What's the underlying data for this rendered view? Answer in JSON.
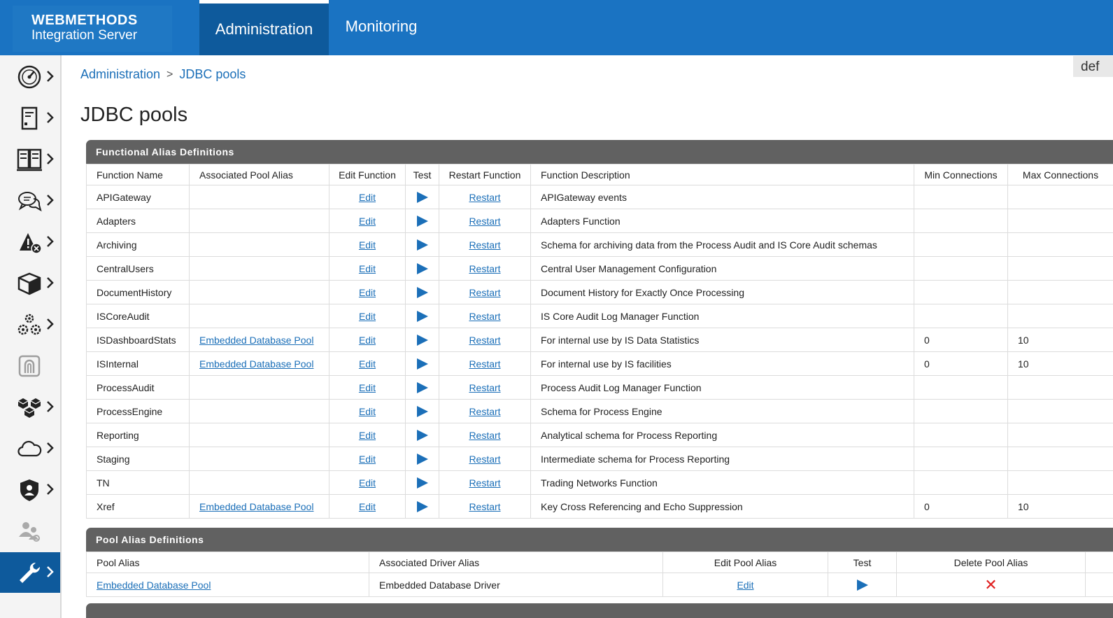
{
  "brand": {
    "line1": "WEBMETHODS",
    "line2": "Integration Server"
  },
  "tabs": [
    {
      "label": "Administration",
      "active": true
    },
    {
      "label": "Monitoring",
      "active": false
    }
  ],
  "sidebar": {
    "items": [
      {
        "icon": "dashboard-gauge-icon"
      },
      {
        "icon": "server-document-icon"
      },
      {
        "icon": "packages-grid-icon"
      },
      {
        "icon": "messaging-chat-icon"
      },
      {
        "icon": "security-alert-icon"
      },
      {
        "icon": "package-box-icon"
      },
      {
        "icon": "settings-gears-icon"
      },
      {
        "icon": "api-portal-icon"
      },
      {
        "icon": "solutions-cubes-icon"
      },
      {
        "icon": "cloud-icon"
      },
      {
        "icon": "security-shield-user-icon"
      },
      {
        "icon": "users-group-icon"
      },
      {
        "icon": "wrench-icon",
        "active": true
      }
    ]
  },
  "breadcrumb": {
    "root": "Administration",
    "separator": ">",
    "current": "JDBC pools"
  },
  "page_title": "JDBC pools",
  "corner_text": "def",
  "functional": {
    "title": "Functional Alias Definitions",
    "headers": [
      "Function Name",
      "Associated Pool Alias",
      "Edit Function",
      "Test",
      "Restart Function",
      "Function Description",
      "Min Connections",
      "Max Connections"
    ],
    "edit_label": "Edit",
    "restart_label": "Restart",
    "rows": [
      {
        "name": "APIGateway",
        "pool": "",
        "desc": "APIGateway events",
        "min": "",
        "max": ""
      },
      {
        "name": "Adapters",
        "pool": "",
        "desc": "Adapters Function",
        "min": "",
        "max": ""
      },
      {
        "name": "Archiving",
        "pool": "",
        "desc": "Schema for archiving data from the Process Audit and IS Core Audit schemas",
        "min": "",
        "max": ""
      },
      {
        "name": "CentralUsers",
        "pool": "",
        "desc": "Central User Management Configuration",
        "min": "",
        "max": ""
      },
      {
        "name": "DocumentHistory",
        "pool": "",
        "desc": "Document History for Exactly Once Processing",
        "min": "",
        "max": ""
      },
      {
        "name": "ISCoreAudit",
        "pool": "",
        "desc": "IS Core Audit Log Manager Function",
        "min": "",
        "max": ""
      },
      {
        "name": "ISDashboardStats",
        "pool": "Embedded Database Pool",
        "desc": "For internal use by IS Data Statistics",
        "min": "0",
        "max": "10"
      },
      {
        "name": "ISInternal",
        "pool": "Embedded Database Pool",
        "desc": "For internal use by IS facilities",
        "min": "0",
        "max": "10"
      },
      {
        "name": "ProcessAudit",
        "pool": "",
        "desc": "Process Audit Log Manager Function",
        "min": "",
        "max": ""
      },
      {
        "name": "ProcessEngine",
        "pool": "",
        "desc": "Schema for Process Engine",
        "min": "",
        "max": ""
      },
      {
        "name": "Reporting",
        "pool": "",
        "desc": "Analytical schema for Process Reporting",
        "min": "",
        "max": ""
      },
      {
        "name": "Staging",
        "pool": "",
        "desc": "Intermediate schema for Process Reporting",
        "min": "",
        "max": ""
      },
      {
        "name": "TN",
        "pool": "",
        "desc": "Trading Networks Function",
        "min": "",
        "max": ""
      },
      {
        "name": "Xref",
        "pool": "Embedded Database Pool",
        "desc": "Key Cross Referencing and Echo Suppression",
        "min": "0",
        "max": "10"
      }
    ]
  },
  "pool": {
    "title": "Pool Alias Definitions",
    "headers": [
      "Pool Alias",
      "Associated Driver Alias",
      "Edit Pool Alias",
      "Test",
      "Delete Pool Alias"
    ],
    "edit_label": "Edit",
    "rows": [
      {
        "alias": "Embedded Database Pool",
        "driver": "Embedded Database Driver"
      }
    ]
  }
}
